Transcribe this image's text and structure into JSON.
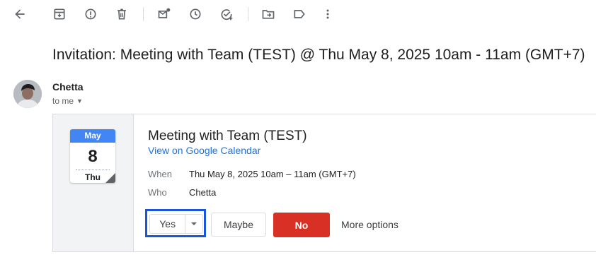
{
  "toolbar": {
    "buttons": [
      {
        "icon": "arrow-left-icon",
        "title": "Back"
      },
      {
        "icon": "archive-icon",
        "title": "Archive"
      },
      {
        "icon": "report-spam-icon",
        "title": "Report spam"
      },
      {
        "icon": "trash-icon",
        "title": "Delete"
      },
      {
        "icon": "mark-unread-icon",
        "title": "Mark as unread"
      },
      {
        "icon": "clock-icon",
        "title": "Snooze"
      },
      {
        "icon": "add-task-icon",
        "title": "Add to Tasks"
      },
      {
        "icon": "move-to-icon",
        "title": "Move to"
      },
      {
        "icon": "label-icon",
        "title": "Labels"
      },
      {
        "icon": "more-vert-icon",
        "title": "More"
      }
    ]
  },
  "email": {
    "subject": "Invitation: Meeting with Team (TEST) @ Thu May 8, 2025 10am - 11am (GMT+7)",
    "sender_name": "Chetta",
    "recipient": "to me"
  },
  "invite": {
    "calendar": {
      "month": "May",
      "day": "8",
      "weekday": "Thu"
    },
    "title": "Meeting with Team (TEST)",
    "calendar_link": "View on Google Calendar",
    "when_label": "When",
    "when_value": "Thu May 8, 2025 10am – 11am (GMT+7)",
    "who_label": "Who",
    "who_value": "Chetta",
    "rsvp": {
      "yes_label": "Yes",
      "maybe_label": "Maybe",
      "no_label": "No",
      "more_options_label": "More options"
    }
  },
  "colors": {
    "calendar_header": "#4285f4",
    "no_button": "#d93025",
    "link": "#1a73e8",
    "focus_outline": "#1a56db"
  }
}
